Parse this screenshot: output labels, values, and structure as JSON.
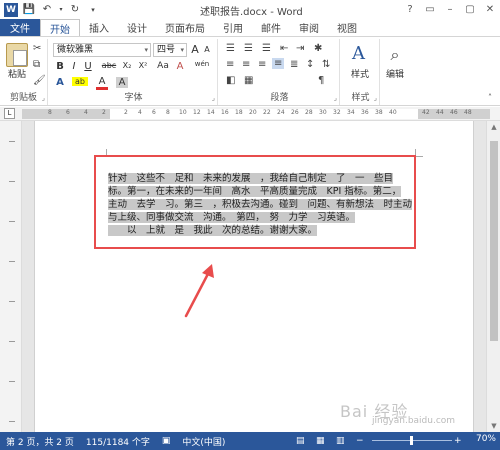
{
  "titlebar": {
    "title": "述职报告.docx - Word",
    "logo_letter": "W",
    "qat_icons": [
      "save-icon",
      "undo-icon",
      "redo-icon",
      "customize-icon"
    ],
    "controls": [
      "?",
      "▭",
      "–",
      "▢",
      "✕"
    ]
  },
  "tabs": {
    "file": "文件",
    "items": [
      "开始",
      "插入",
      "设计",
      "页面布局",
      "引用",
      "邮件",
      "审阅",
      "视图"
    ],
    "active": "开始"
  },
  "ribbon": {
    "clipboard": {
      "paste_label": "粘贴",
      "group_label": "剪贴板"
    },
    "font": {
      "font_name": "微软雅黑",
      "font_size": "四号",
      "size_up": "A",
      "size_down": "A",
      "case_btn": "Aa",
      "clear_btn": "A",
      "wen_btn": "wén",
      "bold": "B",
      "italic": "I",
      "underline": "U",
      "strike": "abc",
      "subscript": "X₂",
      "superscript": "X²",
      "effects": "A",
      "highlight": "ab",
      "font_color": "A",
      "char_shade": "A",
      "group_label": "字体"
    },
    "paragraph": {
      "group_label": "段落"
    },
    "styles": {
      "label": "样式",
      "group_label": "样式"
    },
    "editing": {
      "label": "编辑"
    }
  },
  "ruler": {
    "numbers": [
      "8",
      "6",
      "4",
      "2",
      "2",
      "4",
      "6",
      "8",
      "10",
      "12",
      "14",
      "16",
      "18",
      "20",
      "22",
      "24",
      "26",
      "28",
      "30",
      "32",
      "34",
      "36",
      "38",
      "40",
      "42",
      "44",
      "46",
      "48"
    ],
    "corner": "L"
  },
  "document": {
    "lines": [
      "针对　这些不　足和　未来的发展　，我给自己制定　了　一　些目",
      "标。第一，在未来的一年间　高水　平高质量完成　KPI 指标。第二，",
      "主动　去学　习。第三　，积极去沟通。碰到　问题、有新想法　时主动",
      "与上级、同事做交流　沟通。　第四，　努　力学　习英语。",
      "　　以　上就　是　我此　次的总结。谢谢大家。"
    ]
  },
  "statusbar": {
    "page": "第 2 页，共 2 页",
    "words": "115/1184 个字",
    "proof_icon": "proofing-icon",
    "language": "中文(中国)",
    "zoom": "70%",
    "zoom_minus": "−",
    "zoom_plus": "+"
  },
  "watermark": {
    "text": "Bai 经验",
    "sub": "jingyan.baidu.com"
  },
  "colors": {
    "accent": "#2b579a",
    "highlight_box": "#e84c4c",
    "selection": "#c8c8c8"
  }
}
